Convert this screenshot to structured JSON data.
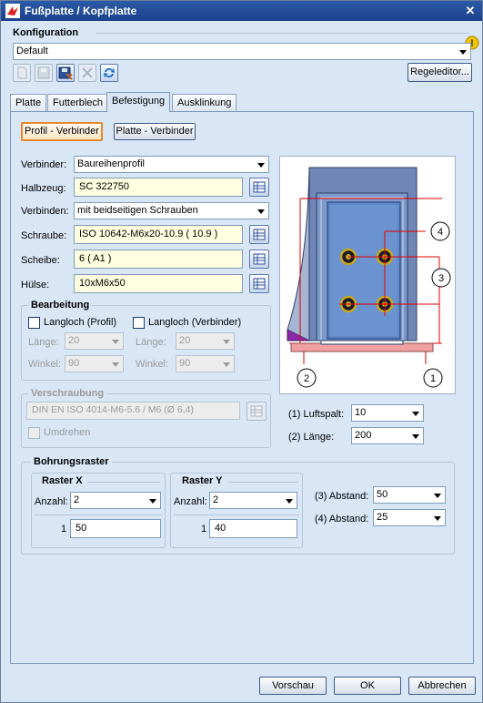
{
  "window": {
    "title": "Fußplatte / Kopfplatte"
  },
  "konfiguration": {
    "label": "Konfiguration",
    "selected": "Default",
    "regeleditor_label": "Regeleditor..."
  },
  "tabs": [
    "Platte",
    "Futterblech",
    "Befestigung",
    "Ausklinkung"
  ],
  "mode_buttons": {
    "profil": "Profil - Verbinder",
    "platte": "Platte - Verbinder"
  },
  "form": {
    "verbinder_label": "Verbinder:",
    "verbinder_value": "Baureihenprofil",
    "halbzeug_label": "Halbzeug:",
    "halbzeug_value": "SC  322750",
    "verbinden_label": "Verbinden:",
    "verbinden_value": "mit beidseitigen Schrauben",
    "schraube_label": "Schraube:",
    "schraube_value": "ISO 10642-M6x20-10.9  ( 10.9 )",
    "scheibe_label": "Scheibe:",
    "scheibe_value": "6  ( A1 )",
    "huelse_label": "Hülse:",
    "huelse_value": "10xM6x50"
  },
  "bearbeitung": {
    "title": "Bearbeitung",
    "langloch_profil": "Langloch (Profil)",
    "langloch_verbinder": "Langloch (Verbinder)",
    "laenge_label": "Länge:",
    "winkel_label": "Winkel:",
    "laenge_left": "20",
    "laenge_right": "20",
    "winkel_left": "90",
    "winkel_right": "90"
  },
  "verschraubung": {
    "title": "Verschraubung",
    "value": "DIN EN ISO 4014-M6-5.6 / M6 (Ø 6,4)",
    "umdrehen": "Umdrehen"
  },
  "diagram": {
    "callout_1": "1",
    "callout_2": "2",
    "callout_3": "3",
    "callout_4": "4"
  },
  "luftspalt": {
    "label": "(1) Luftspalt:",
    "value": "10"
  },
  "laenge2": {
    "label": "(2) Länge:",
    "value": "200"
  },
  "bohrungsraster": {
    "title": "Bohrungsraster",
    "raster_x": {
      "title": "Raster X",
      "anzahl_label": "Anzahl:",
      "anzahl_value": "2",
      "row_index": "1",
      "row_value": "50"
    },
    "raster_y": {
      "title": "Raster Y",
      "anzahl_label": "Anzahl:",
      "anzahl_value": "2",
      "row_index": "1",
      "row_value": "40"
    },
    "abstand3_label": "(3) Abstand:",
    "abstand3_value": "50",
    "abstand4_label": "(4) Abstand:",
    "abstand4_value": "25"
  },
  "footer": {
    "vorschau": "Vorschau",
    "ok": "OK",
    "abbrechen": "Abbrechen"
  },
  "colors": {
    "accent_orange": "#e8862c",
    "field_yellow": "#ffffe1",
    "titlebar": "#1c428a"
  }
}
